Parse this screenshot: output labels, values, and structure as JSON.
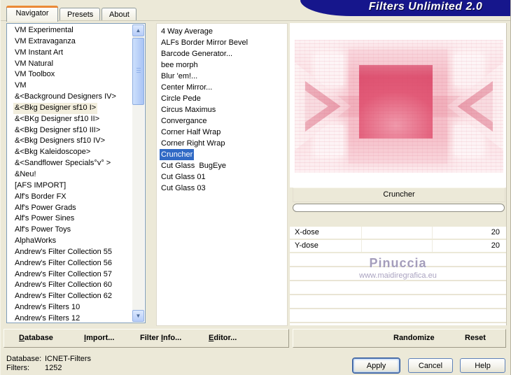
{
  "banner": {
    "title": "Filters Unlimited 2.0"
  },
  "tabs": {
    "navigator": "Navigator",
    "presets": "Presets",
    "about": "About"
  },
  "icons": {
    "scroll_up": "▲",
    "scroll_down": "▼"
  },
  "category_list": {
    "items": [
      "VM Experimental",
      "VM Extravaganza",
      "VM Instant Art",
      "VM Natural",
      "VM Toolbox",
      "VM",
      "&<Background Designers IV>",
      {
        "label": "&<Bkg Designer sf10 I>",
        "selected": true
      },
      "&<BKg Designer sf10 II>",
      "&<Bkg Designer sf10 III>",
      "&<Bkg Designers sf10 IV>",
      "&<Bkg Kaleidoscope>",
      "&<Sandflower Specials°v° >",
      "&Neu!",
      "[AFS IMPORT]",
      "Alf's Border FX",
      "Alf's Power Grads",
      "Alf's Power Sines",
      "Alf's Power Toys",
      "AlphaWorks",
      "Andrew's Filter Collection 55",
      "Andrew's Filter Collection 56",
      "Andrew's Filter Collection 57",
      "Andrew's Filter Collection 60",
      "Andrew's Filter Collection 62",
      "Andrew's Filters 10",
      "Andrew's Filters 12"
    ]
  },
  "filter_list": {
    "items": [
      "4 Way Average",
      "ALFs Border Mirror Bevel",
      "Barcode Generator...",
      "bee morph",
      "Blur 'em!...",
      "Center Mirror...",
      "Circle Pede",
      "Circus Maximus",
      "Convergance",
      "Corner Half Wrap",
      "Corner Right Wrap",
      {
        "label": "Cruncher",
        "selected": true
      },
      "Cut Glass  BugEye",
      "Cut Glass 01",
      "Cut Glass 03"
    ]
  },
  "controls": {
    "header": "Cruncher",
    "sliders": [
      {
        "label": "X-dose",
        "value": "20"
      },
      {
        "label": "Y-dose",
        "value": "20"
      }
    ]
  },
  "watermark": {
    "line1": "Pinuccia",
    "line2": "www.maidiregrafica.eu"
  },
  "toolbar": {
    "database": {
      "pre": "",
      "accel": "D",
      "post": "atabase"
    },
    "import": {
      "pre": "",
      "accel": "I",
      "post": "mport..."
    },
    "filter_info": {
      "pre": "Filter ",
      "accel": "I",
      "post": "nfo..."
    },
    "editor": {
      "pre": "",
      "accel": "E",
      "post": "ditor..."
    },
    "randomize": "Randomize",
    "reset": "Reset"
  },
  "status": {
    "database_label": "Database:",
    "database_value": "ICNET-Filters",
    "filters_label": "Filters:",
    "filters_value": "1252"
  },
  "footer": {
    "apply": "Apply",
    "cancel": "Cancel",
    "help": "Help"
  },
  "colors": {
    "dialog": "#ece9d8",
    "banner": "#16168c",
    "selection": "#316ac5",
    "preview_pink": "#e25b78"
  }
}
